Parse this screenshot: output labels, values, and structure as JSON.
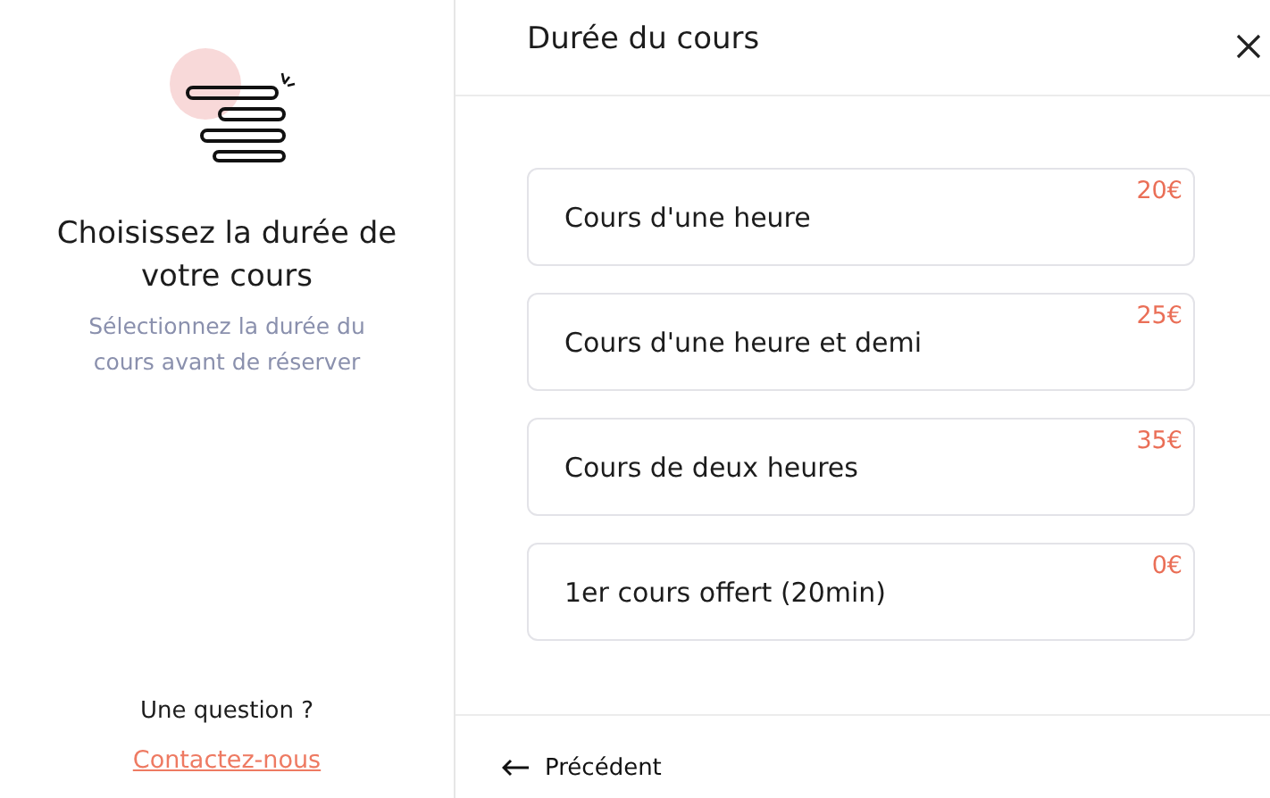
{
  "sidebar": {
    "heading": "Choisissez la durée de votre cours",
    "subtext": "Sélectionnez la durée du cours avant de réserver",
    "question": "Une question ?",
    "contact_link": "Contactez-nous"
  },
  "dialog": {
    "title": "Durée du cours",
    "options": [
      {
        "label": "Cours d'une heure",
        "price": "20€"
      },
      {
        "label": "Cours d'une heure et demi",
        "price": "25€"
      },
      {
        "label": "Cours de deux heures",
        "price": "35€"
      },
      {
        "label": "1er cours offert (20min)",
        "price": "0€"
      }
    ],
    "back_button": "Précédent"
  }
}
